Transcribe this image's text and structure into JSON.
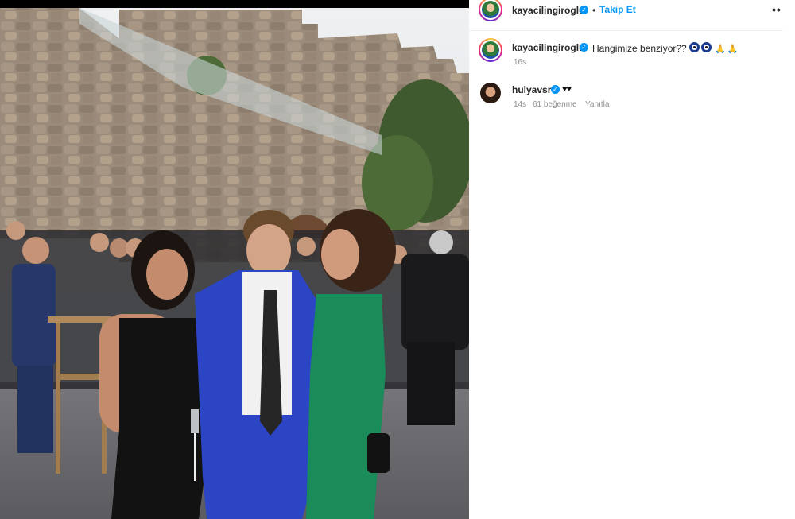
{
  "post": {
    "author": {
      "username": "kayacilingiroglu",
      "verified": true,
      "follow_label": "Takip Et",
      "separator": "•",
      "more_label": "••"
    },
    "caption": {
      "username": "kayacilingiroglu",
      "text": "Hangimize benziyor??",
      "emojis": [
        "nazar-eye-icon",
        "nazar-eye-icon",
        "pray-icon",
        "pray-icon"
      ],
      "time": "16s"
    },
    "comments": [
      {
        "username": "hulyavsr",
        "verified": true,
        "text": "♥♥",
        "time": "14s",
        "likes": "61 beğenme",
        "reply_label": "Yanıtla"
      }
    ]
  },
  "colors": {
    "accent": "#0095f6",
    "text": "#262626",
    "muted": "#8e8e8e"
  }
}
